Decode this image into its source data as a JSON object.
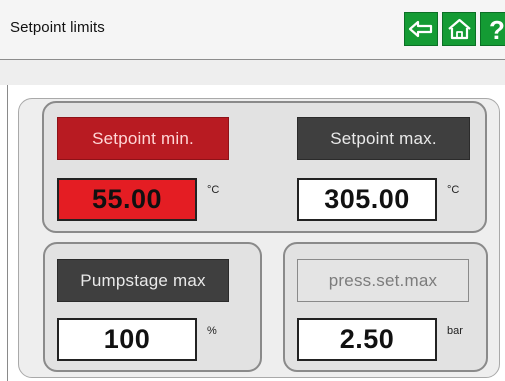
{
  "header": {
    "title": "Setpoint limits",
    "buttons": {
      "back_icon": "back-arrow-icon",
      "home_icon": "home-icon",
      "help_label": "?"
    },
    "colors": {
      "accent_green": "#149b34",
      "alarm_red": "#e41d23",
      "label_red": "#b81b22",
      "label_dark": "#3f3f3f"
    }
  },
  "setpoints": {
    "min": {
      "label": "Setpoint min.",
      "value": "55.00",
      "unit": "°C"
    },
    "max": {
      "label": "Setpoint max.",
      "value": "305.00",
      "unit": "°C"
    }
  },
  "pumpstage": {
    "label": "Pumpstage  max",
    "value": "100",
    "unit": "%"
  },
  "pressure": {
    "label": "press.set.max",
    "value": "2.50",
    "unit": "bar"
  }
}
